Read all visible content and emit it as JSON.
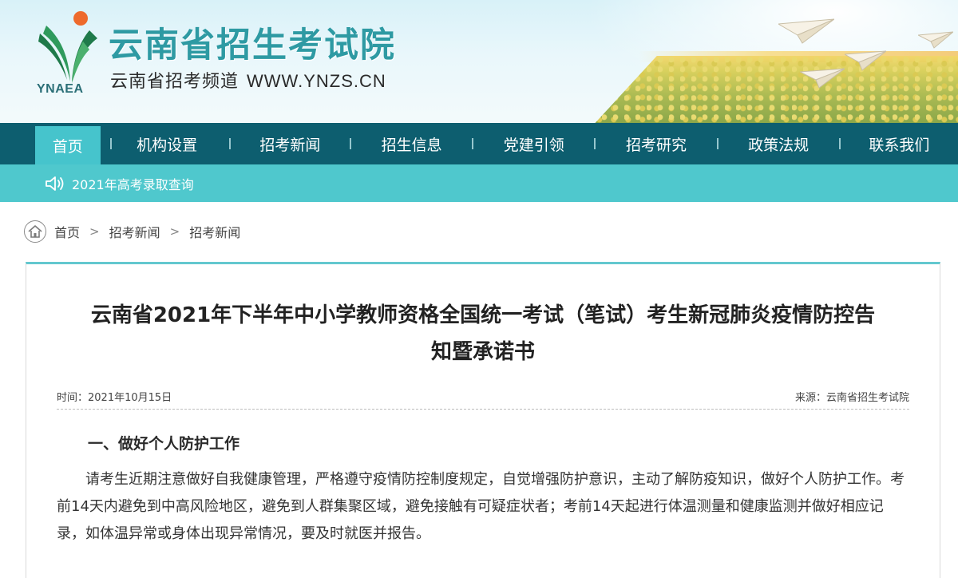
{
  "header": {
    "logo_text": "YNAEA",
    "site_title": "云南省招生考试院",
    "subtitle": "云南省招考频道",
    "url": "WWW.YNZS.CN"
  },
  "nav": {
    "items": [
      {
        "label": "首页",
        "active": true
      },
      {
        "label": "机构设置"
      },
      {
        "label": "招考新闻"
      },
      {
        "label": "招生信息"
      },
      {
        "label": "党建引领"
      },
      {
        "label": "招考研究"
      },
      {
        "label": "政策法规"
      },
      {
        "label": "联系我们"
      }
    ]
  },
  "notice": {
    "icon": "speaker-icon",
    "text": "2021年高考录取查询"
  },
  "breadcrumb": {
    "icon": "home-icon",
    "items": [
      "首页",
      "招考新闻",
      "招考新闻"
    ],
    "separator": ">"
  },
  "article": {
    "title_line1": "云南省2021年下半年中小学教师资格全国统一考试（笔试）考生新冠肺炎疫情防控告",
    "title_line2": "知暨承诺书",
    "time": "时间：2021年10月15日",
    "source": "来源：云南省招生考试院",
    "section_heading": "一、做好个人防护工作",
    "paragraph": "请考生近期注意做好自我健康管理，严格遵守疫情防控制度规定，自觉增强防护意识，主动了解防疫知识，做好个人防护工作。考前14天内避免到中高风险地区，避免到人群集聚区域，避免接触有可疑症状者；考前14天起进行体温测量和健康监测并做好相应记录，如体温异常或身体出现异常情况，要及时就医并报告。"
  },
  "colors": {
    "nav_bg": "#0d5e6f",
    "nav_active": "#46c4cc",
    "notice_bg": "#4fc8cd",
    "title_teal": "#2e9aa3",
    "card_accent": "#63c8cf"
  }
}
